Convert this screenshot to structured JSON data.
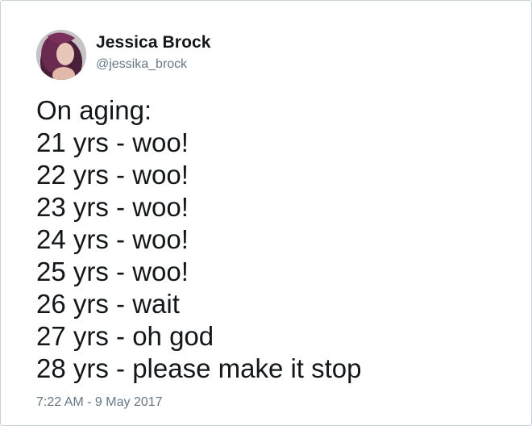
{
  "author": {
    "display_name": "Jessica Brock",
    "handle": "@jessika_brock"
  },
  "tweet": {
    "lines": [
      "On aging:",
      "21 yrs - woo!",
      "22 yrs - woo!",
      "23 yrs - woo!",
      "24 yrs - woo!",
      "25 yrs - woo!",
      "26 yrs - wait",
      "27 yrs - oh god",
      "28 yrs - please make it stop"
    ],
    "timestamp": "7:22 AM - 9 May 2017"
  },
  "colors": {
    "name_text": "#14171a",
    "secondary_text": "#657786",
    "card_border": "#c9d1d8"
  }
}
